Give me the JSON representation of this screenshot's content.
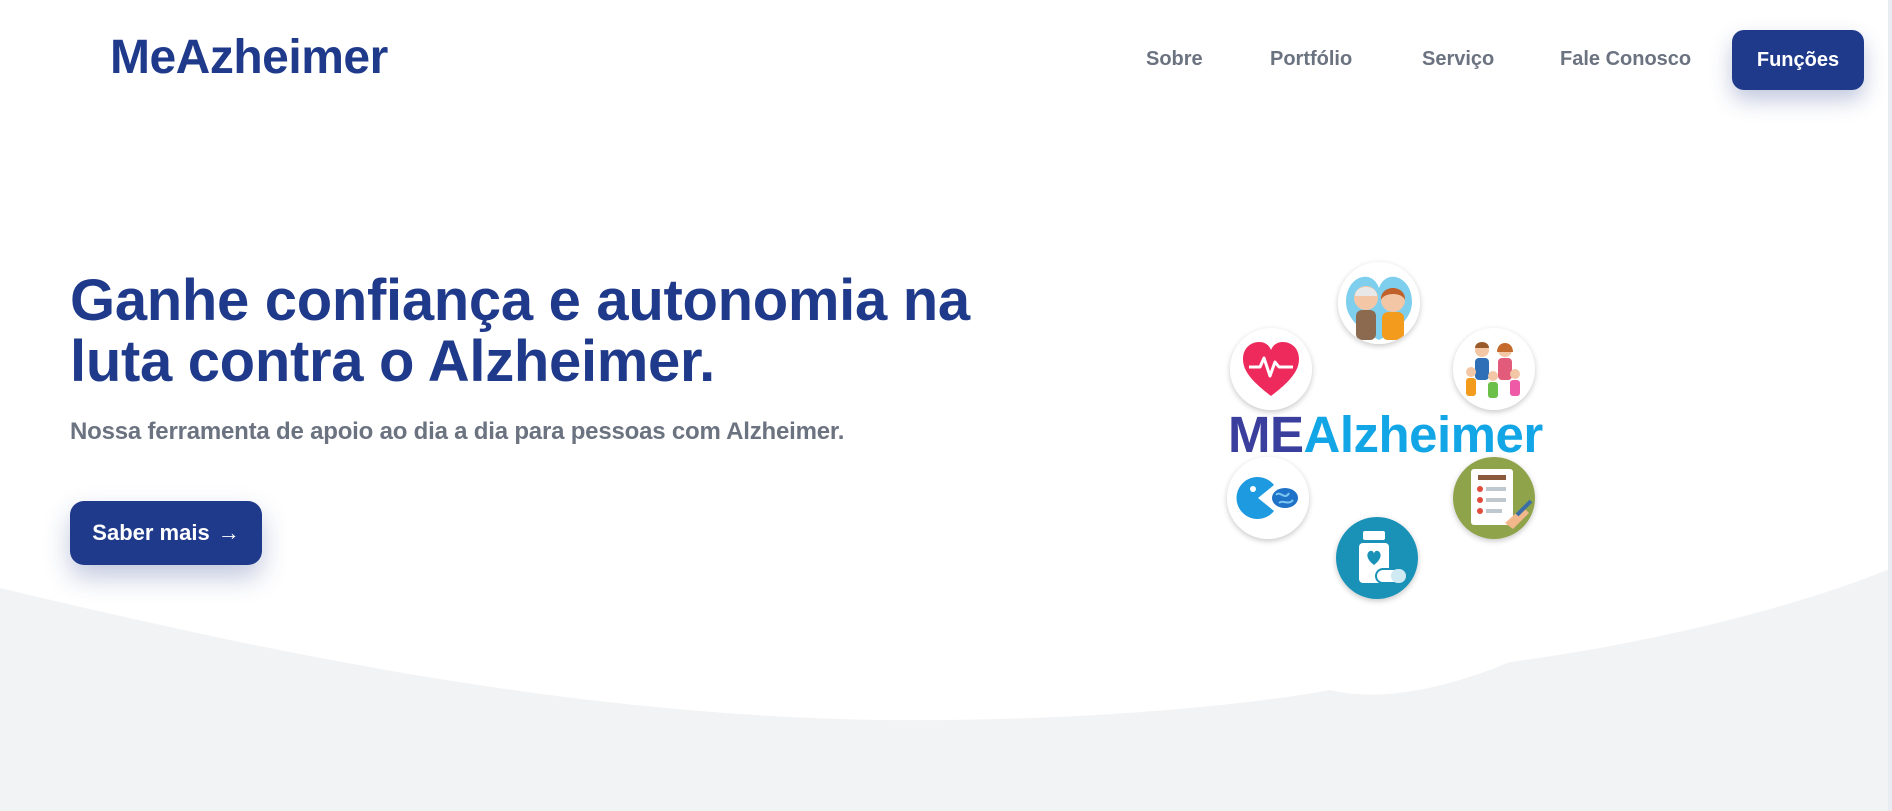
{
  "header": {
    "brand": "MeAzheimer",
    "nav": [
      {
        "label": "Sobre"
      },
      {
        "label": "Portfólio"
      },
      {
        "label": "Serviço"
      },
      {
        "label": "Fale Conosco"
      }
    ],
    "cta_label": "Funções"
  },
  "hero": {
    "title_line1": "Ganhe confiança e autonomia na",
    "title_line2": "luta contra o Alzheimer.",
    "subtitle": "Nossa ferramenta de apoio ao dia a dia para pessoas com Alzheimer.",
    "button_label": "Saber mais",
    "button_icon": "→"
  },
  "logo": {
    "prefix": "ME",
    "suffix": "Alzheimer",
    "icons": [
      "elderly-couple-icon",
      "heart-pulse-icon",
      "family-icon",
      "brain-game-icon",
      "checklist-icon",
      "medication-icon"
    ]
  },
  "colors": {
    "primary": "#1f3a8a",
    "nav_text": "#6b7280",
    "logo_me": "#3a3f9e",
    "logo_alzheimer": "#13a6e6",
    "background_wave": "#f2f3f5"
  }
}
